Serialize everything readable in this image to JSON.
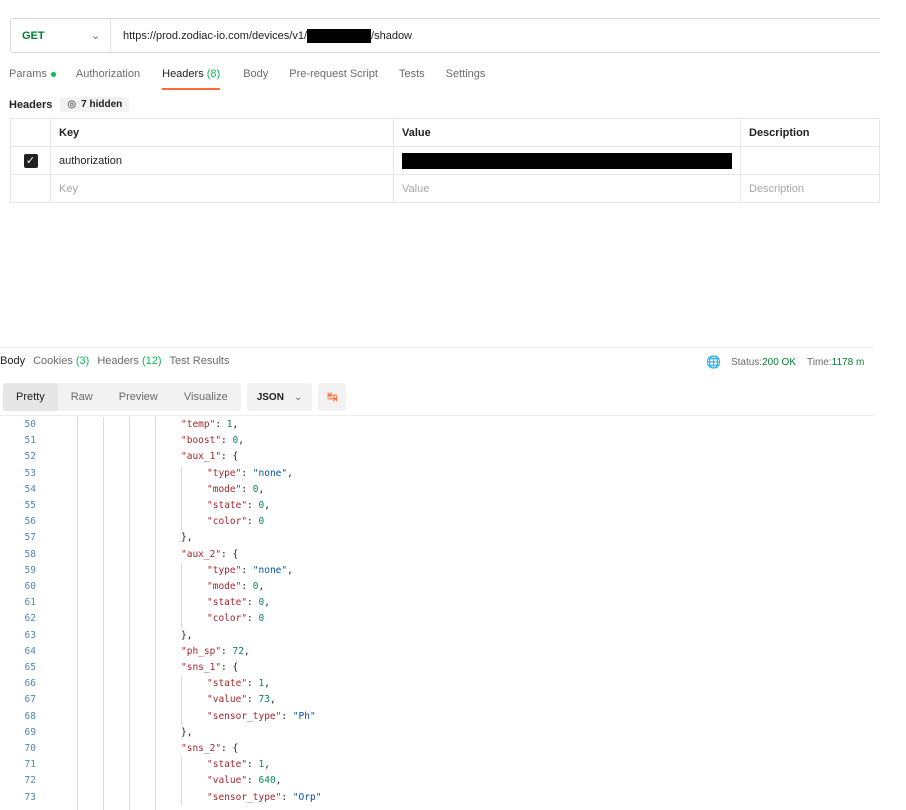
{
  "request": {
    "method": "GET",
    "url_prefix": "https://prod.zodiac-io.com/devices/v1/",
    "url_suffix": "/shadow"
  },
  "request_tabs": [
    {
      "label": "Params",
      "count": "",
      "dot": true
    },
    {
      "label": "Authorization",
      "count": ""
    },
    {
      "label": "Headers ",
      "count": "(8)",
      "active": true
    },
    {
      "label": "Body",
      "count": ""
    },
    {
      "label": "Pre-request Script",
      "count": ""
    },
    {
      "label": "Tests",
      "count": ""
    },
    {
      "label": "Settings",
      "count": ""
    }
  ],
  "headers_section": {
    "label": "Headers",
    "hidden_label": "7 hidden"
  },
  "headers_table": {
    "columns": [
      "Key",
      "Value",
      "Description"
    ],
    "rows": [
      {
        "checked": true,
        "key": "authorization",
        "value": "",
        "description": ""
      }
    ],
    "placeholders": {
      "key": "Key",
      "value": "Value",
      "description": "Description"
    }
  },
  "response_tabs": [
    {
      "label": "Body",
      "count": "",
      "active": true
    },
    {
      "label": "Cookies ",
      "count": "(3)"
    },
    {
      "label": "Headers ",
      "count": "(12)"
    },
    {
      "label": "Test Results",
      "count": ""
    }
  ],
  "status": {
    "status_label": "Status: ",
    "status_value": "200 OK",
    "time_label": "Time: ",
    "time_value": "1178 m"
  },
  "view_tabs": [
    "Pretty",
    "Raw",
    "Preview",
    "Visualize"
  ],
  "active_view": "Pretty",
  "format": "JSON",
  "code_lines": [
    {
      "n": "50",
      "indent": 4,
      "parts": [
        [
          "key",
          "\"temp\""
        ],
        [
          "p",
          ": "
        ],
        [
          "num",
          "1"
        ],
        [
          "p",
          ","
        ]
      ]
    },
    {
      "n": "51",
      "indent": 4,
      "parts": [
        [
          "key",
          "\"boost\""
        ],
        [
          "p",
          ": "
        ],
        [
          "num",
          "0"
        ],
        [
          "p",
          ","
        ]
      ]
    },
    {
      "n": "52",
      "indent": 4,
      "parts": [
        [
          "key",
          "\"aux_1\""
        ],
        [
          "p",
          ": {"
        ]
      ]
    },
    {
      "n": "53",
      "indent": 5,
      "parts": [
        [
          "key",
          "\"type\""
        ],
        [
          "p",
          ": "
        ],
        [
          "str",
          "\"none\""
        ],
        [
          "p",
          ","
        ]
      ]
    },
    {
      "n": "54",
      "indent": 5,
      "parts": [
        [
          "key",
          "\"mode\""
        ],
        [
          "p",
          ": "
        ],
        [
          "num",
          "0"
        ],
        [
          "p",
          ","
        ]
      ]
    },
    {
      "n": "55",
      "indent": 5,
      "parts": [
        [
          "key",
          "\"state\""
        ],
        [
          "p",
          ": "
        ],
        [
          "num",
          "0"
        ],
        [
          "p",
          ","
        ]
      ]
    },
    {
      "n": "56",
      "indent": 5,
      "parts": [
        [
          "key",
          "\"color\""
        ],
        [
          "p",
          ": "
        ],
        [
          "num",
          "0"
        ]
      ]
    },
    {
      "n": "57",
      "indent": 4,
      "parts": [
        [
          "p",
          "},"
        ]
      ]
    },
    {
      "n": "58",
      "indent": 4,
      "parts": [
        [
          "key",
          "\"aux_2\""
        ],
        [
          "p",
          ": {"
        ]
      ]
    },
    {
      "n": "59",
      "indent": 5,
      "parts": [
        [
          "key",
          "\"type\""
        ],
        [
          "p",
          ": "
        ],
        [
          "str",
          "\"none\""
        ],
        [
          "p",
          ","
        ]
      ]
    },
    {
      "n": "60",
      "indent": 5,
      "parts": [
        [
          "key",
          "\"mode\""
        ],
        [
          "p",
          ": "
        ],
        [
          "num",
          "0"
        ],
        [
          "p",
          ","
        ]
      ]
    },
    {
      "n": "61",
      "indent": 5,
      "parts": [
        [
          "key",
          "\"state\""
        ],
        [
          "p",
          ": "
        ],
        [
          "num",
          "0"
        ],
        [
          "p",
          ","
        ]
      ]
    },
    {
      "n": "62",
      "indent": 5,
      "parts": [
        [
          "key",
          "\"color\""
        ],
        [
          "p",
          ": "
        ],
        [
          "num",
          "0"
        ]
      ]
    },
    {
      "n": "63",
      "indent": 4,
      "parts": [
        [
          "p",
          "},"
        ]
      ]
    },
    {
      "n": "64",
      "indent": 4,
      "parts": [
        [
          "key",
          "\"ph_sp\""
        ],
        [
          "p",
          ": "
        ],
        [
          "num",
          "72"
        ],
        [
          "p",
          ","
        ]
      ]
    },
    {
      "n": "65",
      "indent": 4,
      "parts": [
        [
          "key",
          "\"sns_1\""
        ],
        [
          "p",
          ": {"
        ]
      ]
    },
    {
      "n": "66",
      "indent": 5,
      "parts": [
        [
          "key",
          "\"state\""
        ],
        [
          "p",
          ": "
        ],
        [
          "num",
          "1"
        ],
        [
          "p",
          ","
        ]
      ]
    },
    {
      "n": "67",
      "indent": 5,
      "parts": [
        [
          "key",
          "\"value\""
        ],
        [
          "p",
          ": "
        ],
        [
          "num",
          "73"
        ],
        [
          "p",
          ","
        ]
      ]
    },
    {
      "n": "68",
      "indent": 5,
      "parts": [
        [
          "key",
          "\"sensor_type\""
        ],
        [
          "p",
          ": "
        ],
        [
          "str",
          "\"Ph\""
        ]
      ]
    },
    {
      "n": "69",
      "indent": 4,
      "parts": [
        [
          "p",
          "},"
        ]
      ]
    },
    {
      "n": "70",
      "indent": 4,
      "parts": [
        [
          "key",
          "\"sns_2\""
        ],
        [
          "p",
          ": {"
        ]
      ]
    },
    {
      "n": "71",
      "indent": 5,
      "parts": [
        [
          "key",
          "\"state\""
        ],
        [
          "p",
          ": "
        ],
        [
          "num",
          "1"
        ],
        [
          "p",
          ","
        ]
      ]
    },
    {
      "n": "72",
      "indent": 5,
      "parts": [
        [
          "key",
          "\"value\""
        ],
        [
          "p",
          ": "
        ],
        [
          "num",
          "640"
        ],
        [
          "p",
          ","
        ]
      ]
    },
    {
      "n": "73",
      "indent": 5,
      "parts": [
        [
          "key",
          "\"sensor_type\""
        ],
        [
          "p",
          ": "
        ],
        [
          "str",
          "\"Orp\""
        ]
      ]
    }
  ],
  "colors": {
    "accent": "#ff6c37",
    "success": "#0cbb52",
    "method_get": "#007f31"
  }
}
